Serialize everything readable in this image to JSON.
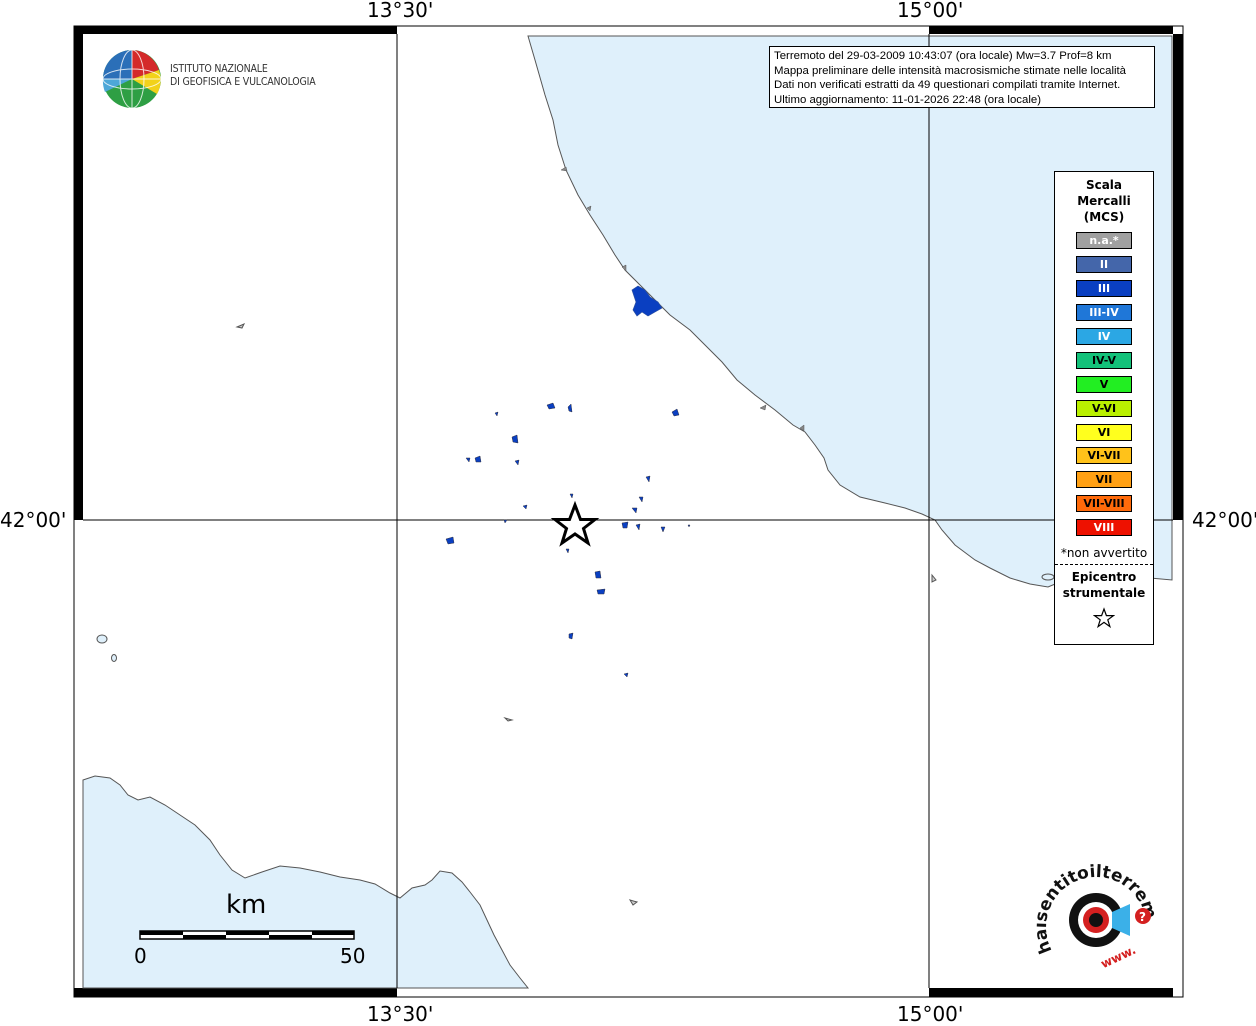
{
  "map": {
    "longitude_labels": [
      "13°30'",
      "15°00'"
    ],
    "latitude_labels": [
      "42°00'"
    ],
    "colors": {
      "sea": "#dff0fb",
      "land": "#ffffff",
      "coast": "#555555",
      "frame": "#000000",
      "intensity_iii": "#0a3fc1"
    }
  },
  "info": {
    "line1": "Terremoto del 29-03-2009 10:43:07 (ora locale) Mw=3.7 Prof=8 km",
    "line2": "Mappa preliminare delle intensità macrosismiche stimate nelle località",
    "line3": "Dati non verificati estratti da 49 questionari compilati tramite Internet.",
    "line4": "Ultimo aggiornamento: 11-01-2026 22:48 (ora locale)"
  },
  "institute": {
    "line1": "ISTITUTO NAZIONALE",
    "line2": "DI GEOFISICA E VULCANOLOGIA"
  },
  "legend": {
    "title_line1": "Scala",
    "title_line2": "Mercalli",
    "title_line3": "(MCS)",
    "items": [
      {
        "label": "n.a.*",
        "color": "#a0a0a0",
        "text_color": "#ffffff"
      },
      {
        "label": "II",
        "color": "#4466aa",
        "text_color": "#ffffff"
      },
      {
        "label": "III",
        "color": "#0a3fc1",
        "text_color": "#ffffff"
      },
      {
        "label": "III-IV",
        "color": "#1f77d8",
        "text_color": "#ffffff"
      },
      {
        "label": "IV",
        "color": "#2ba7e4",
        "text_color": "#ffffff"
      },
      {
        "label": "IV-V",
        "color": "#13c27a",
        "text_color": "#000000"
      },
      {
        "label": "V",
        "color": "#22ee22",
        "text_color": "#000000"
      },
      {
        "label": "V-VI",
        "color": "#b9f000",
        "text_color": "#000000"
      },
      {
        "label": "VI",
        "color": "#ffff1e",
        "text_color": "#000000"
      },
      {
        "label": "VI-VII",
        "color": "#ffc21a",
        "text_color": "#000000"
      },
      {
        "label": "VII",
        "color": "#ffa014",
        "text_color": "#000000"
      },
      {
        "label": "VII-VIII",
        "color": "#ff6a0a",
        "text_color": "#000000"
      },
      {
        "label": "VIII",
        "color": "#ee1100",
        "text_color": "#ffffff"
      }
    ],
    "note": "*non avvertito",
    "epicenter_line1": "Epicentro",
    "epicenter_line2": "strumentale"
  },
  "scale": {
    "unit": "km",
    "min_label": "0",
    "max_label": "50"
  },
  "brand": {
    "site_text": "haisentitoilterremoto.it",
    "www_text": "www."
  }
}
